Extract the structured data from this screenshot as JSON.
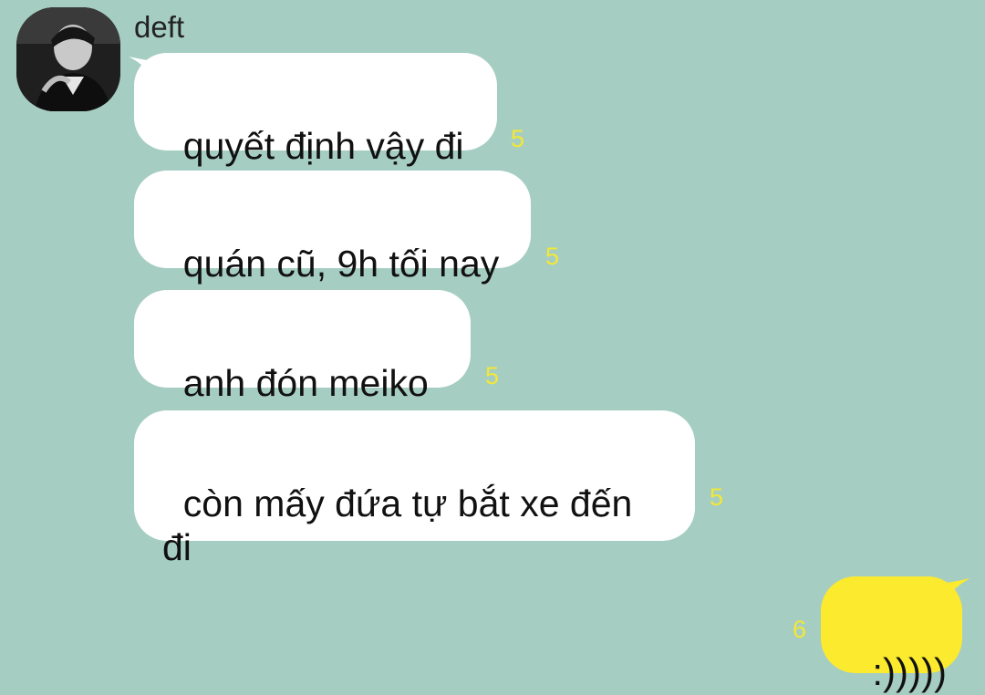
{
  "chat": {
    "sender_name": "deft",
    "avatar_icon": "profile-photo",
    "incoming": [
      {
        "text": "quyết định vậy đi",
        "unread": "5"
      },
      {
        "text": "quán cũ, 9h tối nay",
        "unread": "5"
      },
      {
        "text": "anh đón meiko",
        "unread": "5"
      },
      {
        "text": "còn mấy đứa tự bắt xe đến đi",
        "unread": "5"
      }
    ],
    "outgoing": [
      {
        "text": ":)))))",
        "unread": "6"
      }
    ]
  },
  "colors": {
    "background": "#a6cdc2",
    "incoming_bubble": "#ffffff",
    "outgoing_bubble": "#fcea2e",
    "unread_count": "#f3e836"
  }
}
